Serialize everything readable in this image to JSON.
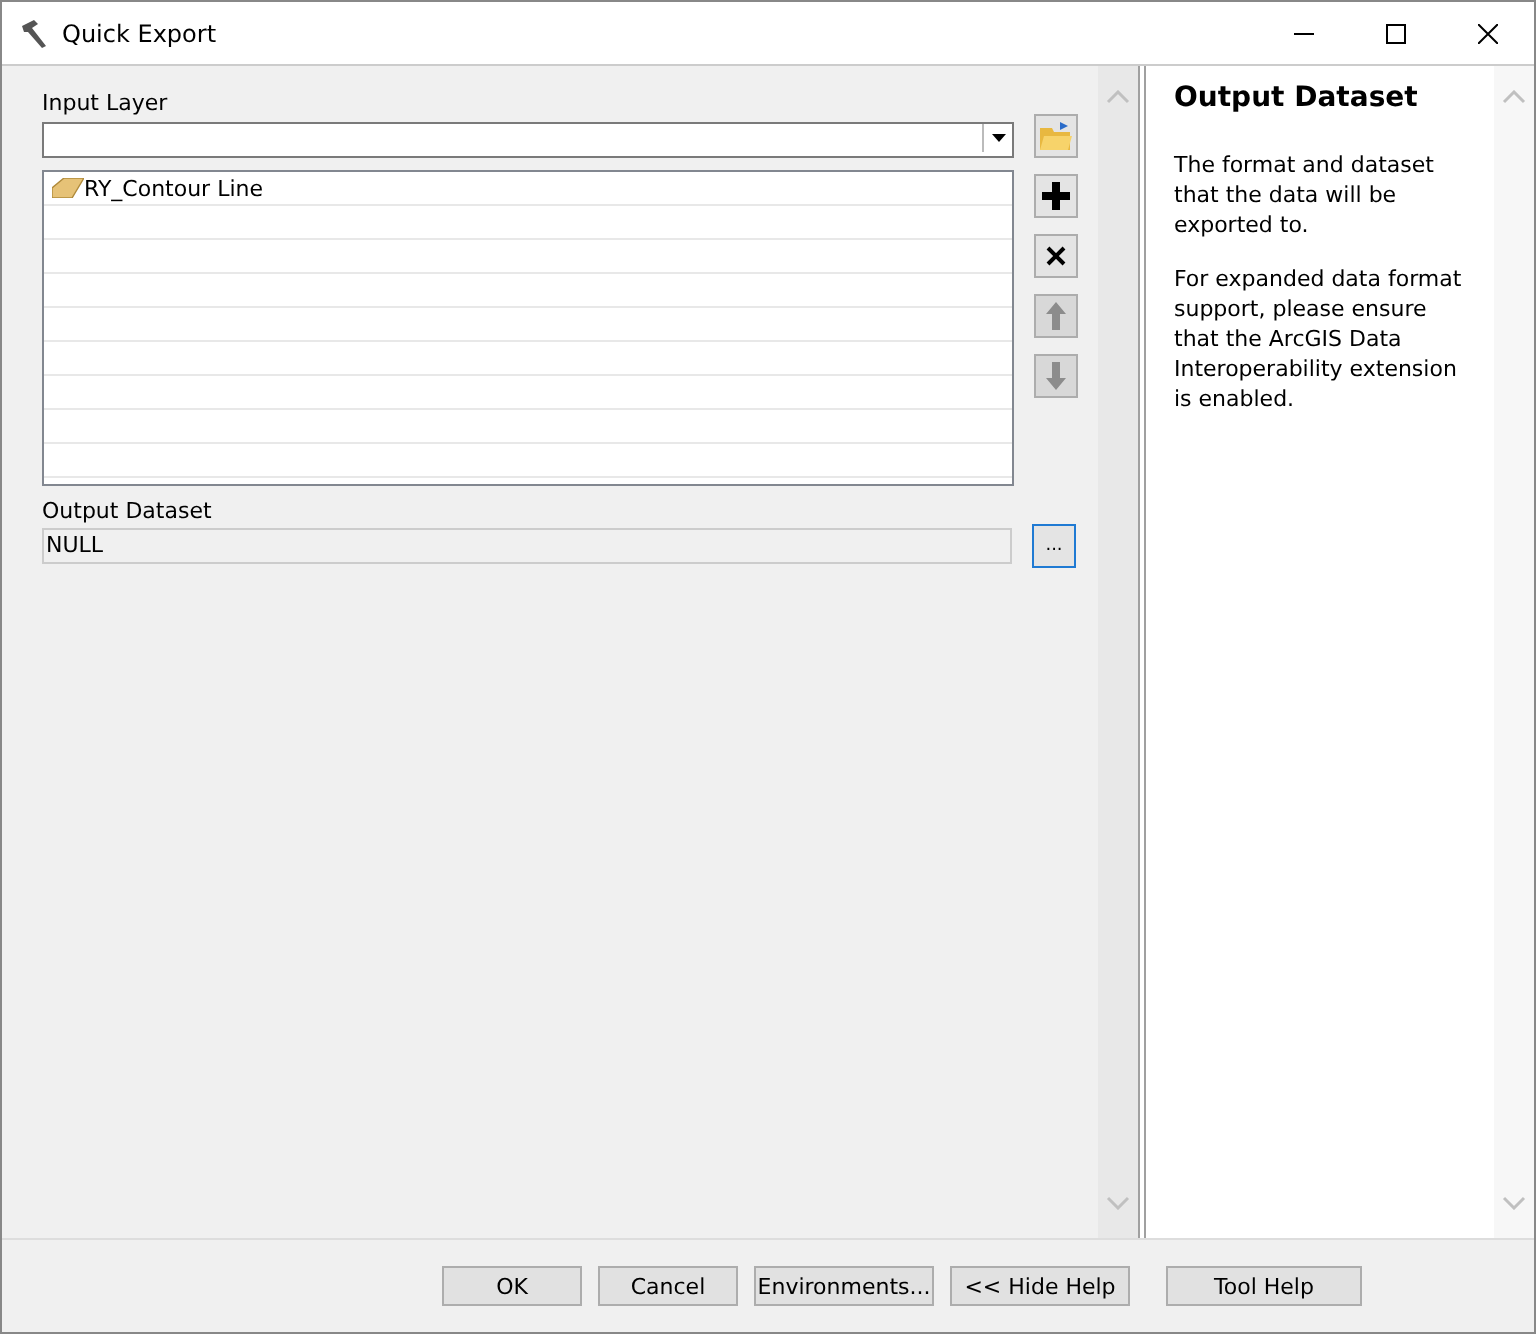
{
  "window": {
    "title": "Quick Export"
  },
  "input_layer": {
    "label": "Input Layer"
  },
  "layers": [
    {
      "name": "RY_Contour Line"
    }
  ],
  "list_tools": [
    {
      "kind": "add",
      "disabled": false
    },
    {
      "kind": "remove",
      "disabled": false
    },
    {
      "kind": "up",
      "disabled": true
    },
    {
      "kind": "down",
      "disabled": true
    }
  ],
  "output_dataset": {
    "label": "Output Dataset",
    "value": "NULL",
    "browse": "..."
  },
  "help": {
    "title": "Output Dataset",
    "paragraphs": [
      "The format and dataset that the data will be exported to.",
      "For expanded data format support, please ensure that the ArcGIS Data Interoperability extension is enabled."
    ]
  },
  "buttons": [
    {
      "label": "OK"
    },
    {
      "label": "Cancel"
    },
    {
      "label": "Environments..."
    },
    {
      "label": "<< Hide Help"
    },
    {
      "label": "Tool Help"
    }
  ]
}
